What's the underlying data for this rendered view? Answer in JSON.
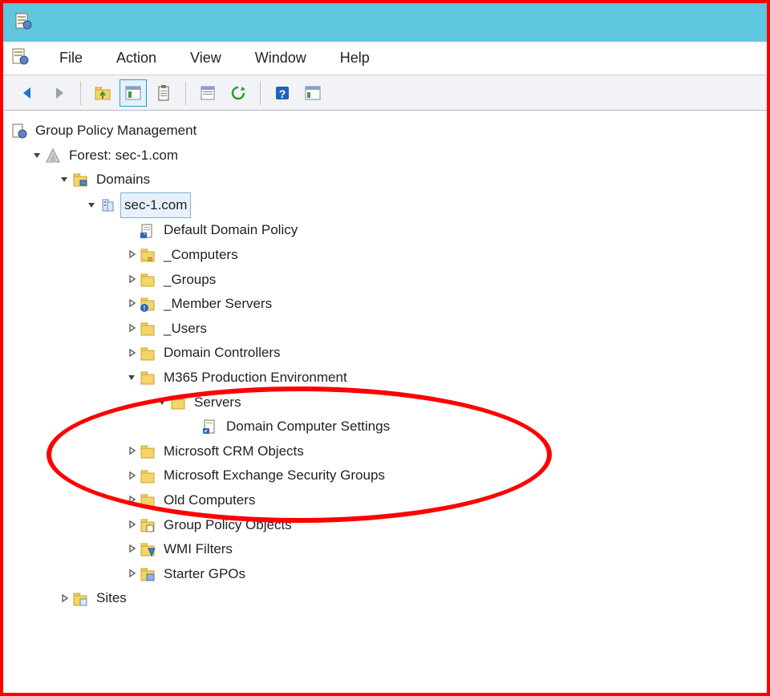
{
  "menubar": [
    {
      "label": "File"
    },
    {
      "label": "Action"
    },
    {
      "label": "View"
    },
    {
      "label": "Window"
    },
    {
      "label": "Help"
    }
  ],
  "toolbar": [
    {
      "name": "back-icon"
    },
    {
      "name": "forward-icon"
    },
    {
      "sep": true
    },
    {
      "name": "up-folder-icon"
    },
    {
      "name": "properties-panel-icon",
      "active": true
    },
    {
      "name": "clipboard-icon"
    },
    {
      "sep": true
    },
    {
      "name": "export-list-icon"
    },
    {
      "name": "refresh-icon"
    },
    {
      "sep": true
    },
    {
      "name": "help-icon"
    },
    {
      "name": "show-hide-action-pane-icon"
    }
  ],
  "tree": {
    "root": {
      "label": "Group Policy Management",
      "icon": "gpm-icon",
      "children": [
        {
          "label": "Forest: sec-1.com",
          "icon": "forest-icon",
          "glyph": "expanded",
          "children": [
            {
              "label": "Domains",
              "icon": "domains-icon",
              "glyph": "expanded",
              "children": [
                {
                  "label": "sec-1.com",
                  "icon": "domain-icon",
                  "glyph": "expanded",
                  "selected": true,
                  "children": [
                    {
                      "label": "Default Domain Policy",
                      "icon": "gpo-link-icon"
                    },
                    {
                      "label": "_Computers",
                      "icon": "ou-icon",
                      "glyph": "collapsed"
                    },
                    {
                      "label": "_Groups",
                      "icon": "ou-icon",
                      "glyph": "collapsed"
                    },
                    {
                      "label": "_Member Servers",
                      "icon": "ou-alert-icon",
                      "glyph": "collapsed"
                    },
                    {
                      "label": "_Users",
                      "icon": "ou-icon",
                      "glyph": "collapsed"
                    },
                    {
                      "label": "Domain Controllers",
                      "icon": "ou-icon",
                      "glyph": "collapsed"
                    },
                    {
                      "label": "M365 Production Environment",
                      "icon": "ou-icon",
                      "glyph": "expanded",
                      "children": [
                        {
                          "label": "Servers",
                          "icon": "ou-icon",
                          "glyph": "expanded",
                          "children": [
                            {
                              "label": "Domain Computer Settings",
                              "icon": "gpo-link-icon"
                            }
                          ]
                        }
                      ]
                    },
                    {
                      "label": "Microsoft CRM Objects",
                      "icon": "ou-icon",
                      "glyph": "collapsed"
                    },
                    {
                      "label": "Microsoft Exchange Security Groups",
                      "icon": "ou-icon",
                      "glyph": "collapsed"
                    },
                    {
                      "label": "Old Computers",
                      "icon": "ou-icon",
                      "glyph": "collapsed"
                    },
                    {
                      "label": "Group Policy Objects",
                      "icon": "gpo-folder-icon",
                      "glyph": "collapsed"
                    },
                    {
                      "label": "WMI Filters",
                      "icon": "wmi-icon",
                      "glyph": "collapsed"
                    },
                    {
                      "label": "Starter GPOs",
                      "icon": "starter-gpo-icon",
                      "glyph": "collapsed"
                    }
                  ]
                }
              ]
            },
            {
              "label": "Sites",
              "icon": "sites-icon",
              "glyph": "collapsed"
            }
          ]
        }
      ]
    }
  }
}
